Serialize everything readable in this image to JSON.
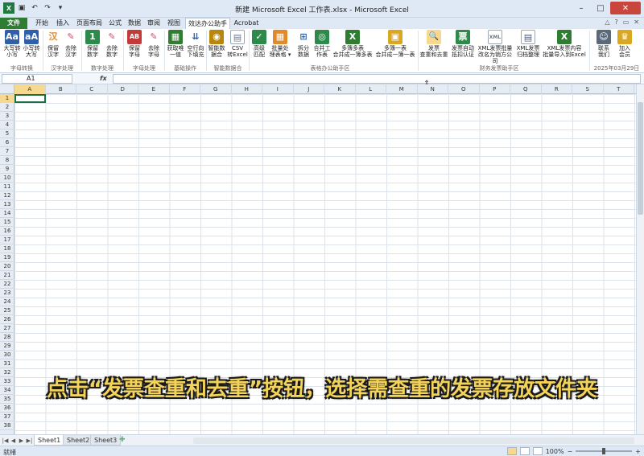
{
  "window": {
    "title": "新建 Microsoft Excel 工作表.xlsx - Microsoft Excel",
    "quick_access": [
      "save-icon",
      "undo-icon",
      "redo-icon",
      "customize-icon"
    ]
  },
  "tabs": {
    "file": "文件",
    "items": [
      "开始",
      "插入",
      "页面布局",
      "公式",
      "数据",
      "审阅",
      "视图",
      "效达办公助手",
      "Acrobat"
    ],
    "active": "效达办公助手"
  },
  "ribbon": {
    "buttons": [
      {
        "label1": "大写转",
        "label2": "小写",
        "icon": "Aa",
        "color": "#2e5fa8"
      },
      {
        "label1": "小写转",
        "label2": "大写",
        "icon": "aA",
        "color": "#2e5fa8"
      },
      {
        "label1": "保留",
        "label2": "汉字",
        "icon": "汉",
        "color": "#e08a2a"
      },
      {
        "label1": "去除",
        "label2": "汉字",
        "icon": "✎",
        "color": "#d44a6a"
      },
      {
        "label1": "保留",
        "label2": "数字",
        "icon": "1",
        "color": "#2e8a4a"
      },
      {
        "label1": "去除",
        "label2": "数字",
        "icon": "✎",
        "color": "#d44a6a"
      },
      {
        "label1": "保留",
        "label2": "字母",
        "icon": "AB",
        "color": "#c23a3a"
      },
      {
        "label1": "去除",
        "label2": "字母",
        "icon": "✎",
        "color": "#d44a6a"
      },
      {
        "label1": "获取唯",
        "label2": "一值",
        "icon": "▦",
        "color": "#2e7d32"
      },
      {
        "label1": "空行向",
        "label2": "下填充",
        "icon": "⇊",
        "color": "#2e5fa8"
      },
      {
        "label1": "智能数",
        "label2": "据合",
        "icon": "◉",
        "color": "#b8860b"
      },
      {
        "label1": "CSV",
        "label2": "转Excel",
        "icon": "▤",
        "color": "#6b7a8a"
      },
      {
        "label1": "高级",
        "label2": "匹配",
        "icon": "✓",
        "color": "#2e8a4a"
      },
      {
        "label1": "批量处",
        "label2": "理表格 ▾",
        "icon": "▦",
        "color": "#e08a2a"
      },
      {
        "label1": "拆分",
        "label2": "数据",
        "icon": "⊞",
        "color": "#2e5fa8"
      },
      {
        "label1": "合并工",
        "label2": "作表",
        "icon": "◎",
        "color": "#2e8a4a"
      },
      {
        "label1": "多簿多表",
        "label2": "合并成一簿多表",
        "icon": "X",
        "color": "#2e7d32"
      },
      {
        "label1": "多簿一表",
        "label2": "合并成一簿一表",
        "icon": "▣",
        "color": "#d9a820"
      },
      {
        "label1": "发票",
        "label2": "查重和去重",
        "icon": "🔍",
        "color": "#e08a2a"
      },
      {
        "label1": "发票自动",
        "label2": "抵扣认证",
        "icon": "票",
        "color": "#2e8a4a"
      },
      {
        "label1": "XML发票批量",
        "label2": "改名为销方公司",
        "icon": "XML",
        "color": "#6b7a8a"
      },
      {
        "label1": "XML发票",
        "label2": "归档整理",
        "icon": "▤",
        "color": "#4a5a7a"
      },
      {
        "label1": "XML发票内容",
        "label2": "批量导入到Excel",
        "icon": "X",
        "color": "#2e7d32"
      },
      {
        "label1": "联系",
        "label2": "我们",
        "icon": "☺",
        "color": "#5a6a7a"
      },
      {
        "label1": "加入",
        "label2": "会员",
        "icon": "♛",
        "color": "#d9a820"
      }
    ],
    "groups": [
      "字母转换",
      "汉字处理",
      "数字处理",
      "字母处理",
      "基础操作",
      "智能数据合",
      "表格办公助手区",
      "财务发票助手区",
      "2025年03月29日"
    ]
  },
  "formula_bar": {
    "name_box": "A1",
    "fx": "fx",
    "value": ""
  },
  "grid": {
    "columns": [
      "A",
      "B",
      "C",
      "D",
      "E",
      "F",
      "G",
      "H",
      "I",
      "J",
      "K",
      "L",
      "M",
      "N",
      "O",
      "P",
      "Q",
      "R",
      "S",
      "T"
    ],
    "rows": [
      "1",
      "2",
      "3",
      "4",
      "5",
      "6",
      "7",
      "8",
      "9",
      "10",
      "11",
      "12",
      "13",
      "14",
      "15",
      "16",
      "17",
      "18",
      "19",
      "20",
      "21",
      "22",
      "23",
      "24",
      "25",
      "26",
      "27",
      "28",
      "29",
      "30",
      "31",
      "32",
      "33",
      "34",
      "35",
      "36",
      "37",
      "38"
    ]
  },
  "sheets": {
    "tabs": [
      "Sheet1",
      "Sheet2",
      "Sheet3"
    ],
    "active": "Sheet1"
  },
  "status": {
    "ready": "就绪",
    "zoom": "100%"
  },
  "caption": "点击“发票查重和去重”按钮，选择需查重的发票存放文件夹"
}
